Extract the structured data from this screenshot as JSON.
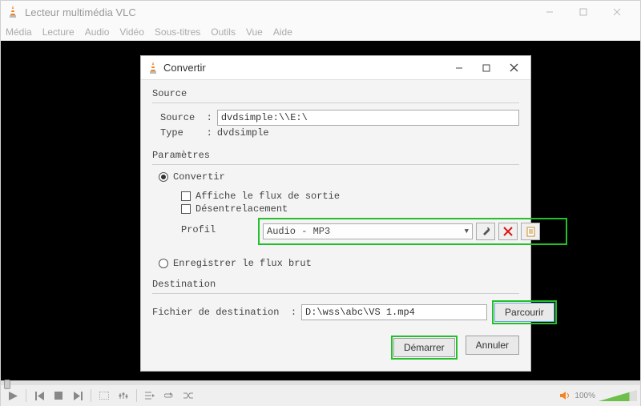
{
  "window": {
    "title": "Lecteur multimédia VLC",
    "menu": [
      "Média",
      "Lecture",
      "Audio",
      "Vidéo",
      "Sous-titres",
      "Outils",
      "Vue",
      "Aide"
    ]
  },
  "controls": {
    "volume_percent": "100%"
  },
  "dialog": {
    "title": "Convertir",
    "source": {
      "group_label": "Source",
      "source_label": "Source  :",
      "source_value": "dvdsimple:\\\\E:\\",
      "type_label": "Type    :",
      "type_value": "dvdsimple"
    },
    "params": {
      "group_label": "Paramètres",
      "convert_label": "Convertir",
      "show_output_label": "Affiche le flux de sortie",
      "deinterlace_label": "Désentrelacement",
      "profile_label": "Profil",
      "profile_value": "Audio - MP3",
      "raw_label": "Enregistrer le flux brut"
    },
    "destination": {
      "group_label": "Destination",
      "file_label": "Fichier de destination  :",
      "file_value": "D:\\wss\\abc\\VS 1.mp4",
      "browse_label": "Parcourir"
    },
    "buttons": {
      "start": "Démarrer",
      "cancel": "Annuler"
    }
  }
}
